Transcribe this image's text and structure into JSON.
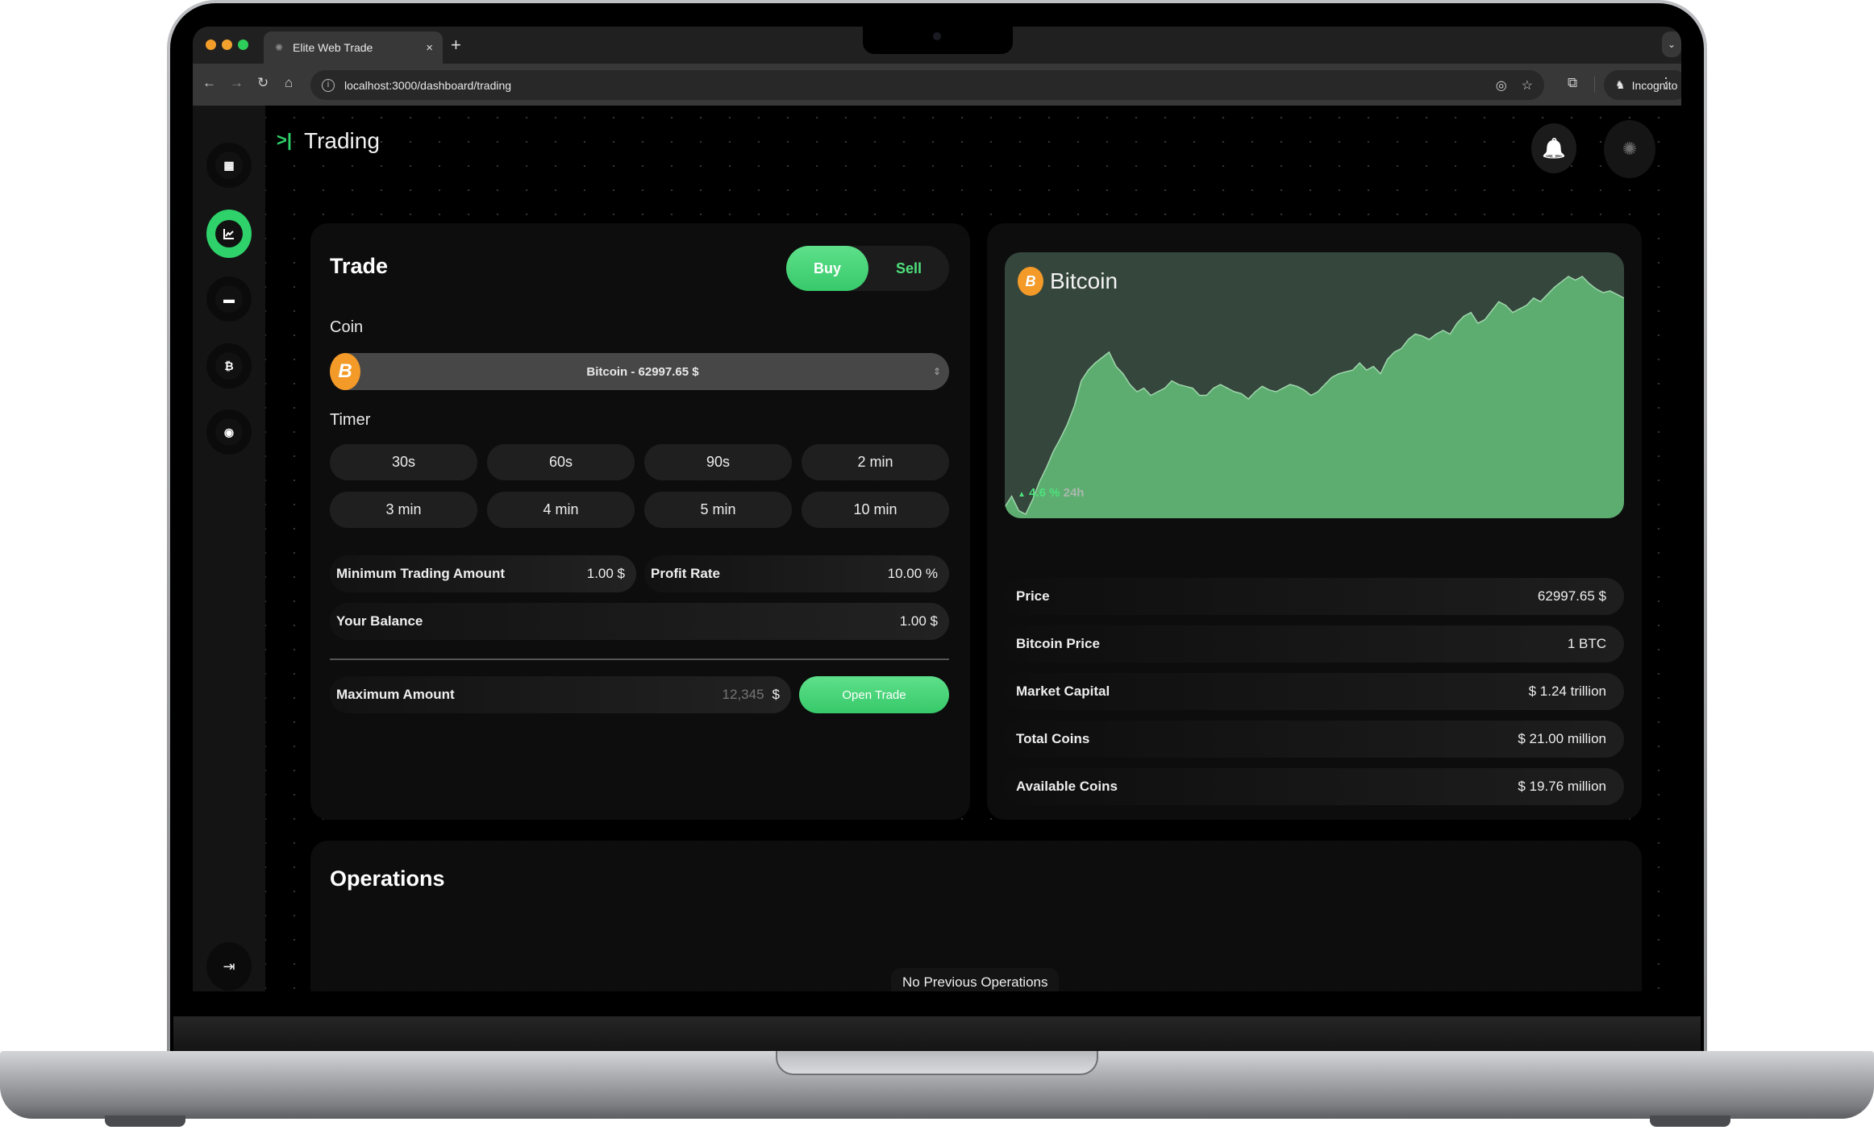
{
  "browser": {
    "tab_title": "Elite Web Trade",
    "tab_close": "×",
    "new_tab": "+",
    "url": "localhost:3000/dashboard/trading",
    "incognito_label": "Incognito",
    "icons": {
      "back": "←",
      "forward": "→",
      "reload": "↻",
      "home": "⌂",
      "info": "i",
      "eye_off": "◎",
      "star": "☆",
      "extension": "⧉",
      "incognito": "♞",
      "kebab": "⋮",
      "tab_menu": "⌄",
      "favicon": "✺"
    },
    "traffic_colors": [
      "#f29d2a",
      "#f2a12e",
      "#2ecc5a"
    ]
  },
  "sidebar": {
    "items": [
      {
        "name": "dashboard",
        "icon": "▦",
        "active": false
      },
      {
        "name": "trading",
        "icon": "📈",
        "active": true
      },
      {
        "name": "cards",
        "icon": "▬",
        "active": false
      },
      {
        "name": "bitcoin",
        "icon": "₿",
        "active": false
      },
      {
        "name": "watch",
        "icon": "◉",
        "active": false
      }
    ],
    "logout_icon": "⇥"
  },
  "header": {
    "toggle_icon": ">|",
    "title": "Trading",
    "bell_icon": "🔔",
    "avatar_icon": "✺"
  },
  "trade": {
    "title": "Trade",
    "buy_label": "Buy",
    "sell_label": "Sell",
    "coin_label": "Coin",
    "coin_icon": "B",
    "coin_selected": "Bitcoin - 62997.65  $",
    "coin_caret": "⇕",
    "timer_label": "Timer",
    "timers": [
      "30s",
      "60s",
      "90s",
      "2 min",
      "3 min",
      "4 min",
      "5 min",
      "10 min"
    ],
    "min_amount_label": "Minimum Trading Amount",
    "min_amount_value": "1.00 $",
    "profit_rate_label": "Profit Rate",
    "profit_rate_value": "10.00 %",
    "balance_label": "Your Balance",
    "balance_value": "1.00 $",
    "max_amount_label": "Maximum Amount",
    "max_amount_placeholder": "12,345",
    "max_amount_currency": "$",
    "open_trade_label": "Open Trade"
  },
  "coin_info": {
    "name": "Bitcoin",
    "icon": "B",
    "change_arrow": "▲",
    "change_value": "4.6 %",
    "change_period": "24h",
    "change_color": "#4ee07c",
    "stats": [
      {
        "label": "Price",
        "value": "62997.65 $"
      },
      {
        "label": "Bitcoin Price",
        "value": "1 BTC"
      },
      {
        "label": "Market Capital",
        "value": "$ 1.24 trillion"
      },
      {
        "label": "Total Coins",
        "value": "$ 21.00 million"
      },
      {
        "label": "Available Coins",
        "value": "$ 19.76 million"
      }
    ]
  },
  "operations": {
    "title": "Operations",
    "empty_message": "No Previous Operations"
  },
  "colors": {
    "accent": "#2ed16a",
    "bitcoin": "#f39a29",
    "chart_fill": "#5dad70",
    "chart_bg": "#35463c"
  },
  "chart_data": {
    "type": "area",
    "title": "Bitcoin",
    "xlabel": "",
    "ylabel": "",
    "annotation": "▲ 4.6 % 24h",
    "grid": false,
    "y_range": [
      0,
      1
    ],
    "values": [
      0.04,
      0.1,
      0.02,
      0.0,
      0.08,
      0.18,
      0.26,
      0.35,
      0.42,
      0.5,
      0.6,
      0.74,
      0.8,
      0.84,
      0.87,
      0.9,
      0.82,
      0.78,
      0.72,
      0.68,
      0.7,
      0.66,
      0.68,
      0.7,
      0.74,
      0.72,
      0.71,
      0.7,
      0.66,
      0.66,
      0.7,
      0.72,
      0.7,
      0.68,
      0.67,
      0.64,
      0.68,
      0.71,
      0.69,
      0.68,
      0.7,
      0.72,
      0.71,
      0.69,
      0.66,
      0.68,
      0.72,
      0.76,
      0.78,
      0.79,
      0.8,
      0.84,
      0.8,
      0.82,
      0.78,
      0.86,
      0.9,
      0.92,
      0.97,
      1.0,
      0.99,
      0.97,
      1.0,
      1.02,
      1.0,
      1.06,
      1.1,
      1.12,
      1.06,
      1.08,
      1.13,
      1.18,
      1.16,
      1.12,
      1.14,
      1.16,
      1.2,
      1.18,
      1.22,
      1.26,
      1.29,
      1.32,
      1.3,
      1.32,
      1.28,
      1.25,
      1.23,
      1.24,
      1.22,
      1.2
    ]
  }
}
